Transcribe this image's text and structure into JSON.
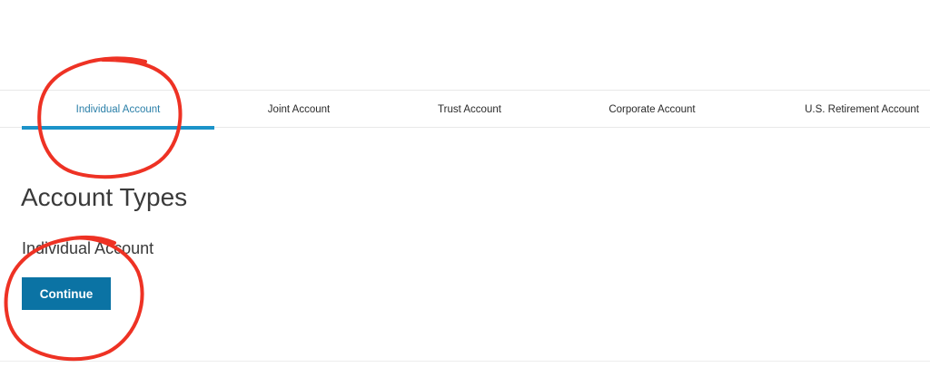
{
  "tabs": [
    {
      "label": "Individual Account",
      "active": true
    },
    {
      "label": "Joint Account",
      "active": false
    },
    {
      "label": "Trust Account",
      "active": false
    },
    {
      "label": "Corporate Account",
      "active": false
    },
    {
      "label": "U.S. Retirement Account",
      "active": false
    }
  ],
  "main": {
    "title": "Account Types",
    "selected_account": "Individual Account",
    "continue_label": "Continue"
  },
  "colors": {
    "active_tab_text": "#2a7fa8",
    "active_tab_underline": "#1c93c9",
    "button_bg": "#0b73a4",
    "annotation_red": "#ee3224"
  }
}
